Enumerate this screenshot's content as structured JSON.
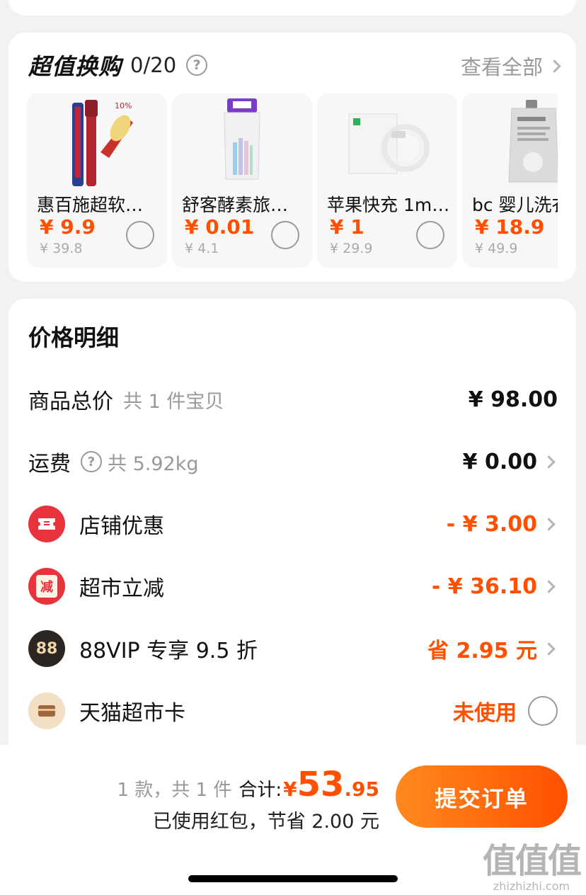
{
  "swap": {
    "title": "超值换购",
    "count": "0/20",
    "help": "?",
    "view_all": "查看全部",
    "products": [
      {
        "name": "惠百施超软…",
        "price": "¥ 9.9",
        "original": "¥ 39.8",
        "thumb": "toothbrush-image"
      },
      {
        "name": "舒客酵素旅…",
        "price": "¥ 0.01",
        "original": "¥ 4.1",
        "thumb": "toothpaste-image"
      },
      {
        "name": "苹果快充 1m…",
        "price": "¥ 1",
        "original": "¥ 29.9",
        "thumb": "usb-cable-image"
      },
      {
        "name": "bc 婴儿洗衣",
        "price": "¥ 18.9",
        "original": "¥ 49.9",
        "thumb": "laundry-detergent-image"
      }
    ]
  },
  "detail": {
    "title": "价格明细",
    "goods_total": {
      "label": "商品总价",
      "sub": "共 1 件宝贝",
      "value": "¥ 98.00"
    },
    "shipping": {
      "label": "运费",
      "help": "?",
      "sub": "共 5.92kg",
      "value": "¥ 0.00"
    },
    "shop_discount": {
      "label": "店铺优惠",
      "value": "- ¥ 3.00",
      "icon": "ticket-icon"
    },
    "market_discount": {
      "label": "超市立减",
      "value": "- ¥ 36.10",
      "icon": "jian-icon",
      "icon_text": "减"
    },
    "vip": {
      "label": "88VIP 专享 9.5 折",
      "value": "省 2.95 元",
      "icon": "vip-88-icon",
      "icon_text": "88"
    },
    "market_card": {
      "label": "天猫超市卡",
      "value": "未使用",
      "icon": "card-icon"
    }
  },
  "bottom": {
    "count_text": "1 款，共 1 件",
    "total_label": "合计:",
    "currency": "¥",
    "total_int": "53",
    "total_dec": ".95",
    "savings": "已使用红包，节省 2.00 元",
    "submit": "提交订单"
  },
  "watermark": {
    "logo": "值值值",
    "url": "zhizhizhi.com"
  },
  "colors": {
    "accent": "#ff5000",
    "icon_red": "#e8323c",
    "vip_dark": "#2b2622",
    "card_gold": "#f2dfc4"
  }
}
